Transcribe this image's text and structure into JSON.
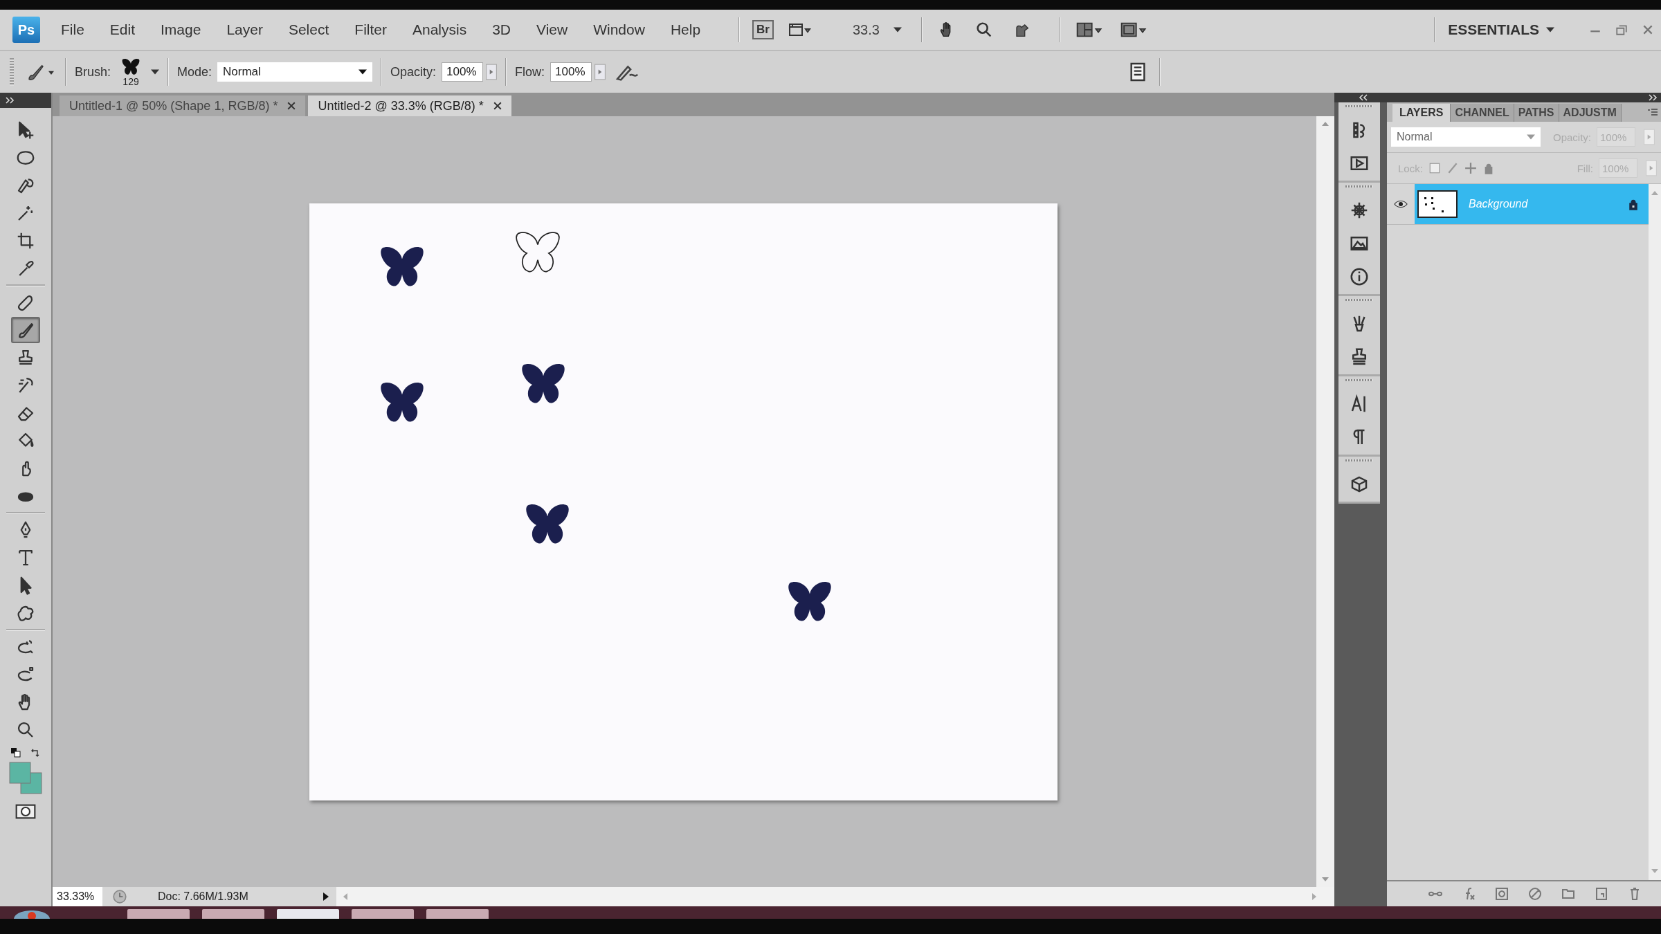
{
  "menu_bar": {
    "logo": "Ps",
    "items": [
      "File",
      "Edit",
      "Image",
      "Layer",
      "Select",
      "Filter",
      "Analysis",
      "3D",
      "View",
      "Window",
      "Help"
    ],
    "bridge": "Br",
    "zoom": "33.3",
    "workspace": "ESSENTIALS"
  },
  "options_bar": {
    "brush_label": "Brush:",
    "brush_size": "129",
    "mode_label": "Mode:",
    "mode": "Normal",
    "opacity_label": "Opacity:",
    "opacity": "100%",
    "flow_label": "Flow:",
    "flow": "100%"
  },
  "document_tabs": [
    {
      "title": "Untitled-1 @ 50% (Shape 1, RGB/8) *",
      "selected": false
    },
    {
      "title": "Untitled-2 @ 33.3% (RGB/8) *",
      "selected": true
    }
  ],
  "toolbox": {
    "tools": [
      {
        "selected": false
      },
      {
        "selected": false
      },
      {
        "selected": false
      },
      {
        "selected": false
      },
      {
        "selected": false
      },
      {
        "selected": false
      },
      {
        "selected": false
      },
      {
        "selected": true
      },
      {
        "selected": false
      },
      {
        "selected": false
      },
      {
        "selected": false
      },
      {
        "selected": false
      },
      {
        "selected": false
      },
      {
        "selected": false
      },
      {
        "selected": false
      },
      {
        "selected": false
      },
      {
        "selected": false
      },
      {
        "selected": false
      },
      {
        "selected": false
      },
      {
        "selected": false
      },
      {
        "selected": false
      },
      {
        "selected": false
      }
    ],
    "swatches": [
      {
        "color": "#5bb5a3"
      },
      {
        "color": "#5bb5a3"
      }
    ]
  },
  "canvas": {
    "shapes": [
      {
        "kind": "filled"
      },
      {
        "kind": "outline"
      },
      {
        "kind": "filled"
      },
      {
        "kind": "filled"
      },
      {
        "kind": "filled"
      },
      {
        "kind": "filled"
      }
    ]
  },
  "layers_panel": {
    "tabs": [
      {
        "label": "LAYERS",
        "selected": true
      },
      {
        "label": "CHANNEL",
        "selected": false
      },
      {
        "label": "PATHS",
        "selected": false
      },
      {
        "label": "ADJUSTM",
        "selected": false
      }
    ],
    "blend_mode": "Normal",
    "opacity_label": "Opacity:",
    "opacity": "100%",
    "lock_label": "Lock:",
    "fill_label": "Fill:",
    "fill": "100%",
    "layers": [
      {
        "name": "Background",
        "visible": true,
        "locked": true,
        "selected": true
      }
    ]
  },
  "status_bar": {
    "zoom": "33.33%",
    "doc_info": "Doc: 7.66M/1.93M"
  }
}
